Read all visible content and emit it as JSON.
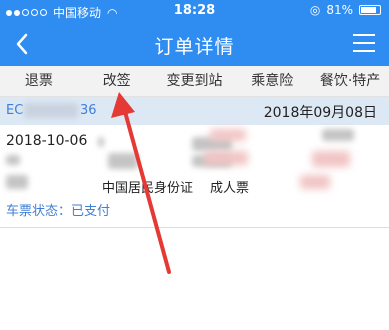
{
  "status_bar": {
    "carrier": "中国移动",
    "time": "18:28",
    "battery_percent": "81%",
    "battery_level": 0.81
  },
  "nav": {
    "title": "订单详情"
  },
  "actions": [
    {
      "label": "退票"
    },
    {
      "label": "改签"
    },
    {
      "label": "变更到站"
    },
    {
      "label": "乘意险"
    },
    {
      "label": "餐饮·特产"
    }
  ],
  "order": {
    "number_prefix": "EC",
    "number_suffix": "36",
    "date": "2018年09月08日"
  },
  "ticket": {
    "travel_date": "2018-10-06",
    "id_type": "中国居民身份证",
    "ticket_type": "成人票",
    "status_label": "车票状态：",
    "status_value": "已支付"
  },
  "colors": {
    "primary": "#2f8cf1",
    "link_blue": "#3f7fd6",
    "arrow_red": "#e53935"
  }
}
